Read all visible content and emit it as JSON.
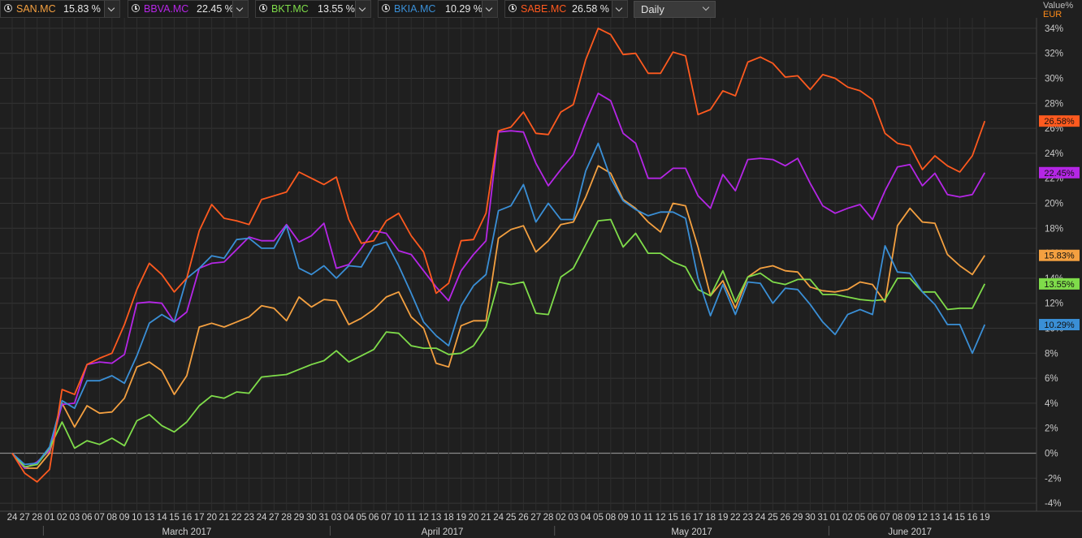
{
  "toolbar": {
    "symbols": [
      {
        "name": "SAN.MC",
        "pct": "15.83 %",
        "color": "#f4a040"
      },
      {
        "name": "BBVA.MC",
        "pct": "22.45 %",
        "color": "#b526e6"
      },
      {
        "name": "BKT.MC",
        "pct": "13.55 %",
        "color": "#7fdc4a"
      },
      {
        "name": "BKIA.MC",
        "pct": "10.29 %",
        "color": "#3a8fd6"
      },
      {
        "name": "SABE.MC",
        "pct": "26.58 %",
        "color": "#ff5a1f"
      }
    ],
    "period": "Daily"
  },
  "axis": {
    "value_label": "Value%",
    "currency": "EUR"
  },
  "chart_data": {
    "type": "line",
    "x": [
      "24",
      "27",
      "28",
      "01",
      "02",
      "03",
      "06",
      "07",
      "08",
      "09",
      "10",
      "13",
      "14",
      "15",
      "16",
      "17",
      "20",
      "21",
      "22",
      "23",
      "24",
      "27",
      "28",
      "29",
      "30",
      "31",
      "03",
      "04",
      "05",
      "06",
      "07",
      "10",
      "11",
      "12",
      "13",
      "18",
      "19",
      "20",
      "21",
      "24",
      "25",
      "26",
      "27",
      "28",
      "02",
      "03",
      "04",
      "05",
      "08",
      "09",
      "10",
      "11",
      "12",
      "15",
      "16",
      "17",
      "18",
      "19",
      "22",
      "23",
      "24",
      "25",
      "26",
      "29",
      "30",
      "31",
      "01",
      "02",
      "05",
      "06",
      "07",
      "08",
      "09",
      "12",
      "13",
      "14",
      "15",
      "16",
      "19"
    ],
    "months": [
      {
        "label": "March 2017",
        "start_index": 3,
        "end_index": 25
      },
      {
        "label": "April 2017",
        "start_index": 26,
        "end_index": 43
      },
      {
        "label": "May 2017",
        "start_index": 44,
        "end_index": 65
      },
      {
        "label": "June 2017",
        "start_index": 66,
        "end_index": 78
      }
    ],
    "ylim": [
      -4,
      35
    ],
    "yticks": [
      -4,
      -2,
      0,
      2,
      4,
      6,
      8,
      10,
      12,
      14,
      16,
      18,
      20,
      22,
      24,
      26,
      28,
      30,
      32,
      34
    ],
    "ytick_suffix": "%",
    "grid": true,
    "series": [
      {
        "name": "SAN.MC",
        "color": "#f4a040",
        "last_label": "15.83%",
        "values": [
          0,
          -1.2,
          -1.2,
          0,
          4,
          2.1,
          3.8,
          3.2,
          3.3,
          4.4,
          6.9,
          7.3,
          6.6,
          4.7,
          6.2,
          10.1,
          10.4,
          10.1,
          10.5,
          10.9,
          11.8,
          11.6,
          10.6,
          12.5,
          11.7,
          12.3,
          12.2,
          10.3,
          10.8,
          11.5,
          12.5,
          12.9,
          10.9,
          10.0,
          7.2,
          6.9,
          10.2,
          10.6,
          10.6,
          17.2,
          17.9,
          18.2,
          16.1,
          17.0,
          18.3,
          18.5,
          20.5,
          23.0,
          22.4,
          20.3,
          19.6,
          18.5,
          17.7,
          20.0,
          19.8,
          16.5,
          12.6,
          13.8,
          11.6,
          14.1,
          14.8,
          15.0,
          14.6,
          14.5,
          13.3,
          13.0,
          12.9,
          13.1,
          13.7,
          13.5,
          12.1,
          18.2,
          19.6,
          18.5,
          18.4,
          15.9,
          15.0,
          14.3,
          15.83
        ]
      },
      {
        "name": "BBVA.MC",
        "color": "#b526e6",
        "last_label": "22.45%",
        "values": [
          0,
          -1.2,
          -0.7,
          0.2,
          3.9,
          4.0,
          7.1,
          7.3,
          7.2,
          7.9,
          12.0,
          12.1,
          12.0,
          10.5,
          11.3,
          14.8,
          15.2,
          15.3,
          16.3,
          17.3,
          17.0,
          17.0,
          18.3,
          16.9,
          17.4,
          18.4,
          14.8,
          15.1,
          16.4,
          17.8,
          17.6,
          16.2,
          15.9,
          14.6,
          13.3,
          12.2,
          14.6,
          15.9,
          17.0,
          25.7,
          25.8,
          25.7,
          23.2,
          21.4,
          22.7,
          23.9,
          26.5,
          28.8,
          28.2,
          25.6,
          24.8,
          22.0,
          22.0,
          22.8,
          22.8,
          20.6,
          19.6,
          22.3,
          21.0,
          23.5,
          23.6,
          23.5,
          23.0,
          23.6,
          21.6,
          19.8,
          19.2,
          19.6,
          19.9,
          18.7,
          21.0,
          22.9,
          23.1,
          21.4,
          22.4,
          20.7,
          20.5,
          20.7,
          22.45
        ]
      },
      {
        "name": "BKT.MC",
        "color": "#7fdc4a",
        "last_label": "13.55%",
        "values": [
          0,
          -1.1,
          -0.9,
          0.4,
          2.5,
          0.4,
          1.0,
          0.7,
          1.2,
          0.6,
          2.6,
          3.1,
          2.2,
          1.7,
          2.5,
          3.8,
          4.6,
          4.4,
          4.9,
          4.8,
          6.1,
          6.2,
          6.3,
          6.7,
          7.1,
          7.4,
          8.2,
          7.3,
          7.8,
          8.3,
          9.7,
          9.6,
          8.6,
          8.4,
          8.4,
          7.9,
          8.0,
          8.6,
          10.1,
          13.7,
          13.5,
          13.7,
          11.2,
          11.1,
          14.1,
          14.8,
          16.7,
          18.6,
          18.7,
          16.5,
          17.6,
          16.0,
          16.0,
          15.3,
          14.9,
          13.1,
          12.6,
          14.6,
          12.1,
          14.1,
          14.4,
          13.7,
          13.5,
          13.9,
          13.9,
          12.7,
          12.7,
          12.5,
          12.3,
          12.2,
          12.3,
          14.0,
          14.0,
          12.9,
          12.9,
          11.5,
          11.6,
          11.6,
          13.55
        ]
      },
      {
        "name": "BKIA.MC",
        "color": "#3a8fd6",
        "last_label": "10.29%",
        "values": [
          0,
          -0.9,
          -0.8,
          0.5,
          4.2,
          3.6,
          5.8,
          5.8,
          6.2,
          5.6,
          7.8,
          10.4,
          11.1,
          10.5,
          14.0,
          14.8,
          15.8,
          15.6,
          17.1,
          17.2,
          16.4,
          16.4,
          18.2,
          14.8,
          14.3,
          15.0,
          14.0,
          15.0,
          14.9,
          16.6,
          16.9,
          15.0,
          12.8,
          10.5,
          9.4,
          8.6,
          11.8,
          13.4,
          14.3,
          19.4,
          19.8,
          21.5,
          18.5,
          20.0,
          18.7,
          18.7,
          22.6,
          24.8,
          22.0,
          20.2,
          19.5,
          19.0,
          19.3,
          19.3,
          18.8,
          14.0,
          11.0,
          13.5,
          11.1,
          13.7,
          13.6,
          12.0,
          13.2,
          13.1,
          11.9,
          10.5,
          9.5,
          11.1,
          11.5,
          11.1,
          16.6,
          14.5,
          14.4,
          12.9,
          11.9,
          10.3,
          10.3,
          8.0,
          10.29
        ]
      },
      {
        "name": "SABE.MC",
        "color": "#ff5a1f",
        "last_label": "26.58%",
        "values": [
          0,
          -1.6,
          -2.3,
          -1.3,
          5.1,
          4.7,
          7.1,
          7.6,
          8.0,
          10.3,
          13.1,
          15.2,
          14.3,
          12.9,
          14.0,
          17.8,
          19.9,
          18.8,
          18.6,
          18.3,
          20.3,
          20.6,
          20.9,
          22.5,
          22.0,
          21.5,
          22.1,
          18.7,
          16.8,
          17.0,
          18.6,
          19.2,
          17.4,
          16.1,
          12.8,
          13.6,
          17.0,
          17.1,
          19.2,
          25.8,
          26.1,
          27.3,
          25.6,
          25.5,
          27.3,
          27.9,
          31.5,
          34.0,
          33.5,
          31.9,
          32.0,
          30.4,
          30.4,
          32.1,
          31.8,
          27.1,
          27.5,
          29.0,
          28.6,
          31.3,
          31.7,
          31.2,
          30.1,
          30.2,
          29.1,
          30.3,
          30.0,
          29.3,
          29.0,
          28.3,
          25.6,
          24.8,
          24.6,
          22.7,
          23.8,
          23.0,
          22.5,
          23.8,
          26.58
        ]
      }
    ]
  }
}
